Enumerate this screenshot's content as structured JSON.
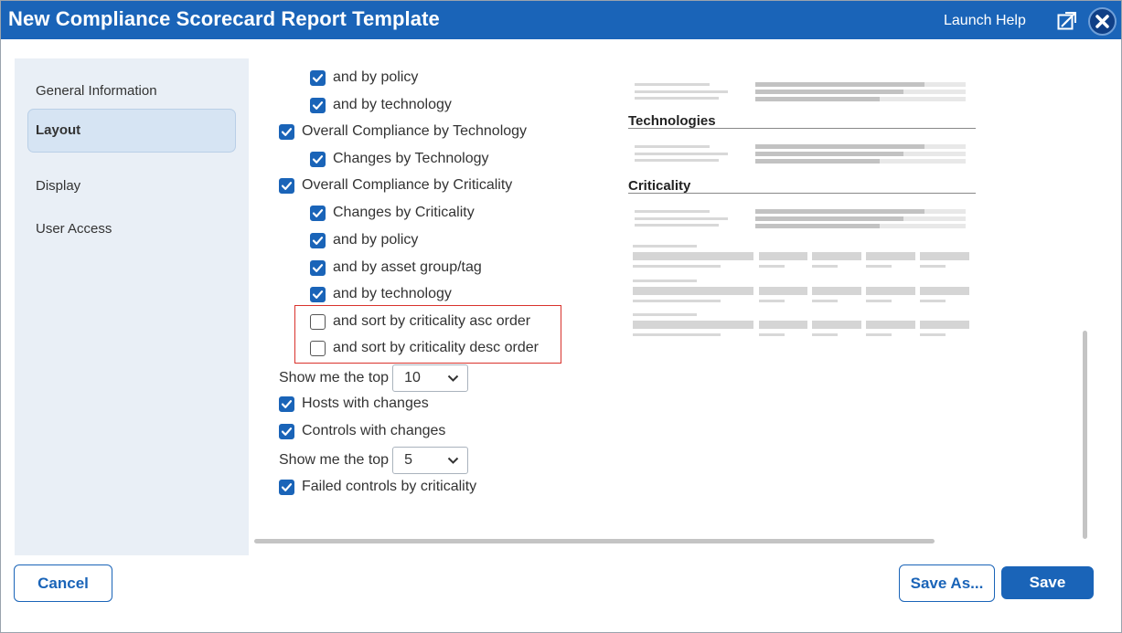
{
  "window": {
    "title": "New Compliance Scorecard Report Template",
    "launch_help": "Launch Help"
  },
  "sidebar": {
    "items": [
      {
        "label": "General Information",
        "active": false
      },
      {
        "label": "Layout",
        "active": true
      },
      {
        "label": "Display",
        "active": false
      },
      {
        "label": "User Access",
        "active": false
      }
    ]
  },
  "options": [
    {
      "label": "and by policy",
      "checked": true
    },
    {
      "label": "and by technology",
      "checked": true
    },
    {
      "label": "Overall Compliance by Technology",
      "checked": true
    },
    {
      "label": "Changes by Technology",
      "checked": true
    },
    {
      "label": "Overall Compliance by Criticality",
      "checked": true
    },
    {
      "label": "Changes by Criticality",
      "checked": true
    },
    {
      "label": "and by policy",
      "checked": true
    },
    {
      "label": "and by asset group/tag",
      "checked": true
    },
    {
      "label": "and by technology",
      "checked": true
    },
    {
      "label": "and sort by criticality asc order",
      "checked": false
    },
    {
      "label": "and sort by criticality desc order",
      "checked": false
    },
    {
      "label": "Hosts with changes",
      "checked": true
    },
    {
      "label": "Controls with changes",
      "checked": true
    },
    {
      "label": "Failed controls by criticality",
      "checked": true
    }
  ],
  "top_selectors": [
    {
      "label": "Show me the top",
      "value": "10"
    },
    {
      "label": "Show me the top",
      "value": "5"
    }
  ],
  "preview": {
    "headings": [
      "Technologies",
      "Criticality"
    ]
  },
  "buttons": {
    "cancel": "Cancel",
    "save_as": "Save As...",
    "save": "Save"
  },
  "colors": {
    "title_bar": "#1a64b8",
    "accent": "#1a64b8",
    "highlight_border": "#d9322c",
    "sidebar_bg": "#e9eff6"
  }
}
